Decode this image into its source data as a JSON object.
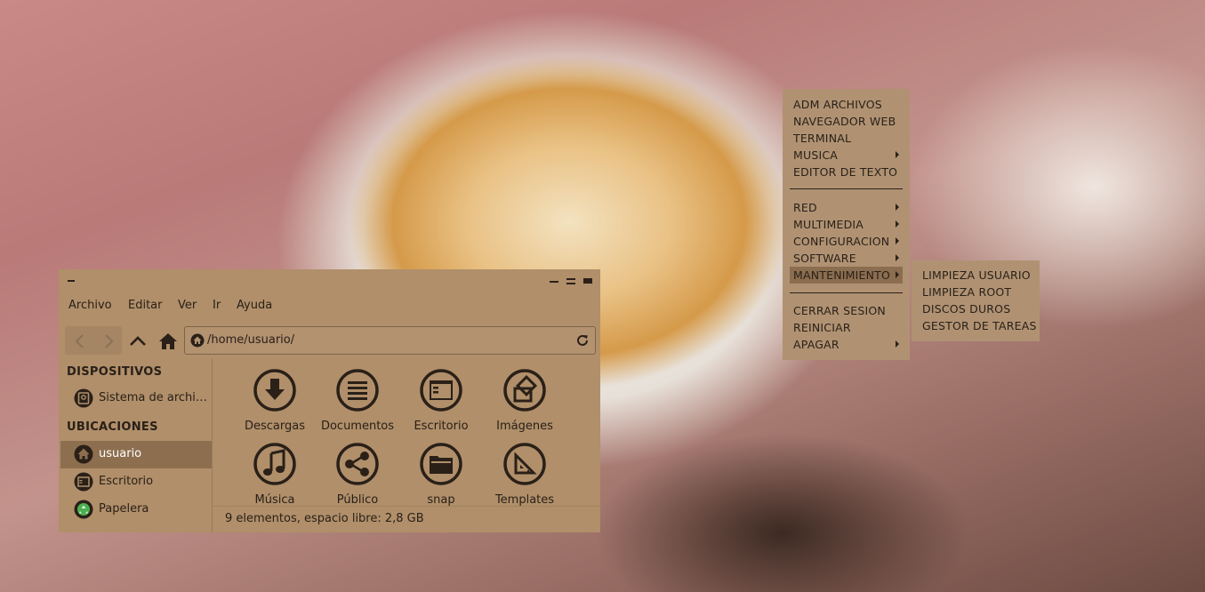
{
  "colors": {
    "panel": "#b08f6a",
    "menu": "#b09273",
    "selection": "#8b6d50",
    "text": "#2a2018",
    "recycle_green": "#4caf50"
  },
  "file_manager": {
    "menubar": [
      "Archivo",
      "Editar",
      "Ver",
      "Ir",
      "Ayuda"
    ],
    "path": "/home/usuario/",
    "sidebar": {
      "devices_header": "DISPOSITIVOS",
      "devices": [
        {
          "label": "Sistema de archi…",
          "icon": "drive-icon"
        }
      ],
      "places_header": "UBICACIONES",
      "places": [
        {
          "label": "usuario",
          "icon": "home-icon",
          "active": true
        },
        {
          "label": "Escritorio",
          "icon": "desktop-icon"
        },
        {
          "label": "Papelera",
          "icon": "trash-icon"
        }
      ]
    },
    "items": [
      {
        "label": "Descargas",
        "icon": "download-icon"
      },
      {
        "label": "Documentos",
        "icon": "document-icon"
      },
      {
        "label": "Escritorio",
        "icon": "desktop-icon"
      },
      {
        "label": "Imágenes",
        "icon": "image-icon"
      },
      {
        "label": "Música",
        "icon": "music-icon"
      },
      {
        "label": "Público",
        "icon": "share-icon"
      },
      {
        "label": "snap",
        "icon": "folder-icon"
      },
      {
        "label": "Templates",
        "icon": "template-icon"
      }
    ],
    "status": "9 elementos, espacio libre: 2,8 GB"
  },
  "main_menu": {
    "group1": [
      {
        "label": "ADM ARCHIVOS",
        "submenu": false
      },
      {
        "label": "NAVEGADOR WEB",
        "submenu": false
      },
      {
        "label": "TERMINAL",
        "submenu": false
      },
      {
        "label": "MUSICA",
        "submenu": true
      },
      {
        "label": "EDITOR DE TEXTO",
        "submenu": false
      }
    ],
    "group2": [
      {
        "label": "RED",
        "submenu": true
      },
      {
        "label": "MULTIMEDIA",
        "submenu": true
      },
      {
        "label": "CONFIGURACION",
        "submenu": true
      },
      {
        "label": "SOFTWARE",
        "submenu": true
      },
      {
        "label": "MANTENIMIENTO",
        "submenu": true,
        "selected": true
      }
    ],
    "group3": [
      {
        "label": "CERRAR SESION",
        "submenu": false
      },
      {
        "label": "REINICIAR",
        "submenu": false
      },
      {
        "label": "APAGAR",
        "submenu": true
      }
    ]
  },
  "sub_menu": {
    "items": [
      "LIMPIEZA USUARIO",
      "LIMPIEZA ROOT",
      "DISCOS DUROS",
      "GESTOR DE TAREAS"
    ]
  }
}
